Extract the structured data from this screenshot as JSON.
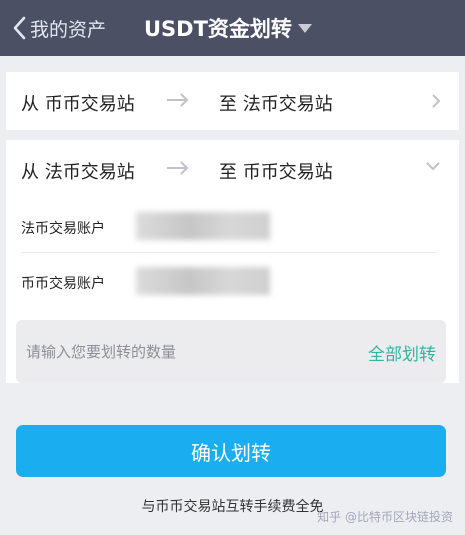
{
  "header": {
    "back_label": "我的资产",
    "title": "USDT资金划转"
  },
  "route_collapsed": {
    "from": "从 币币交易站",
    "to": "至 法币交易站"
  },
  "route_expanded": {
    "from": "从 法币交易站",
    "to": "至 币币交易站",
    "accounts": [
      {
        "label": "法币交易账户",
        "value": ""
      },
      {
        "label": "币币交易账户",
        "value": ""
      }
    ]
  },
  "amount": {
    "placeholder": "请输入您要划转的数量",
    "value": "",
    "all_label": "全部划转"
  },
  "confirm_label": "确认划转",
  "note": "与币币交易站互转手续费全免",
  "watermark": "知乎 @比特币区块链投资",
  "colors": {
    "header_bg": "#4b5064",
    "accent_blue": "#1aaef0",
    "accent_green": "#2fb6a0",
    "page_bg": "#eceef2"
  }
}
